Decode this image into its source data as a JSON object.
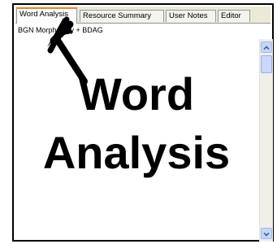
{
  "tabs": [
    {
      "label": "Word Analysis",
      "active": true
    },
    {
      "label": "Resource Summary",
      "active": false
    },
    {
      "label": "User Notes",
      "active": false
    },
    {
      "label": "Editor",
      "active": false
    }
  ],
  "subheader": {
    "text": "BGN Morphology + BDAG"
  },
  "content": {
    "line1": "Word",
    "line2": "Analysis"
  },
  "icons": {
    "arrow": "up-left-arrow-icon",
    "scroll_up": "chevron-up-icon",
    "scroll_down": "chevron-down-icon"
  },
  "colors": {
    "tab_strip": "#ece9d8",
    "active_tab_accent": "#e68b2c",
    "scrollbar_button": "#c5d6fb"
  }
}
